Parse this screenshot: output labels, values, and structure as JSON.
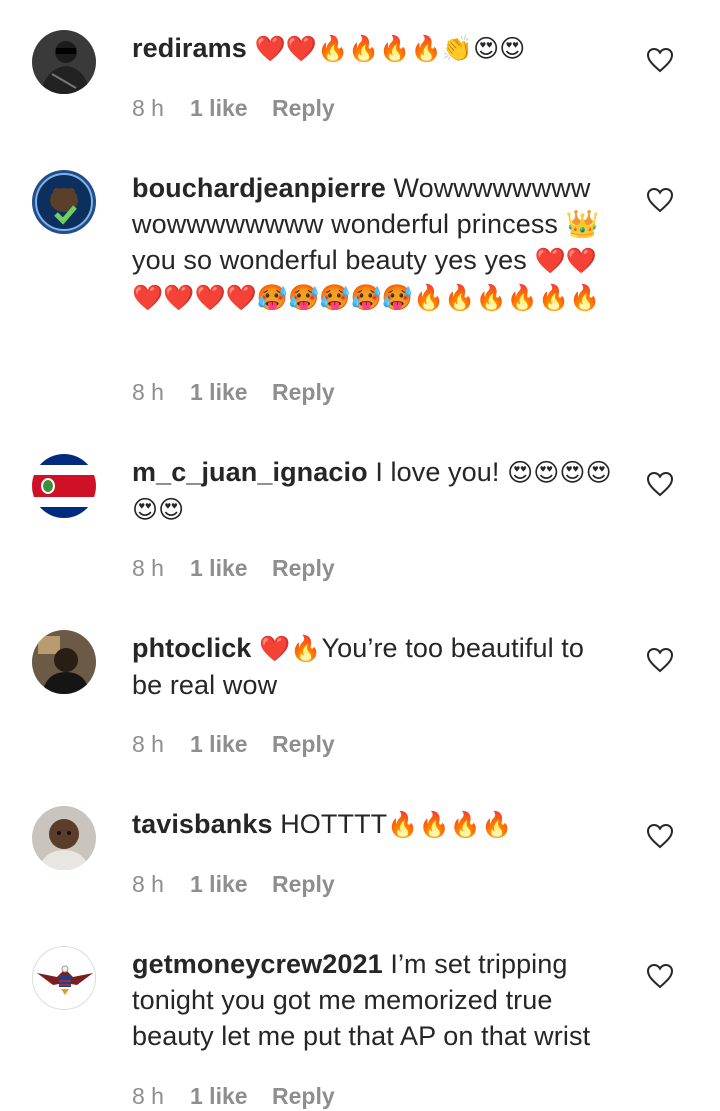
{
  "comments": [
    {
      "username": "redirams",
      "text": "",
      "emoji": "❤️❤️🔥🔥🔥🔥👏😍😍",
      "time": "8 h",
      "likes": "1 like",
      "reply": "Reply",
      "avatar": "dark-person-avatar"
    },
    {
      "username": "bouchardjeanpierre",
      "text": "Wowwwwwwww wowwwwwwww wonderful princess 👑 you so wonderful beauty yes yes",
      "emoji": "❤️❤️❤️❤️❤️❤️🥵🥵🥵🥵🥵🔥🔥🔥🔥🔥🔥",
      "time": "8 h",
      "likes": "1 like",
      "reply": "Reply",
      "avatar": "bear-vaccine-badge-avatar"
    },
    {
      "username": "m_c_juan_ignacio",
      "text": "I love you!",
      "emoji": "😍😍😍😍😍😍",
      "time": "8 h",
      "likes": "1 like",
      "reply": "Reply",
      "avatar": "costa-rica-flag-avatar"
    },
    {
      "username": "phtoclick",
      "text": "You’re too beautiful to be real wow",
      "emoji_before": "❤️🔥",
      "time": "8 h",
      "likes": "1 like",
      "reply": "Reply",
      "avatar": "person-avatar"
    },
    {
      "username": "tavisbanks",
      "text": "HOTTTT",
      "emoji": "🔥🔥🔥🔥",
      "time": "8 h",
      "likes": "1 like",
      "reply": "Reply",
      "avatar": "baby-avatar"
    },
    {
      "username": "getmoneycrew2021",
      "text": "I’m set tripping tonight you got me memorized true beauty let me put that AP on that wrist",
      "emoji": "",
      "time": "8 h",
      "likes": "1 like",
      "reply": "Reply",
      "avatar": "eagle-flag-avatar"
    }
  ],
  "colors": {
    "text": "#262626",
    "meta": "#8e8e8e",
    "heart_outline": "#262626"
  },
  "icons": [
    "heart-outline-icon"
  ]
}
